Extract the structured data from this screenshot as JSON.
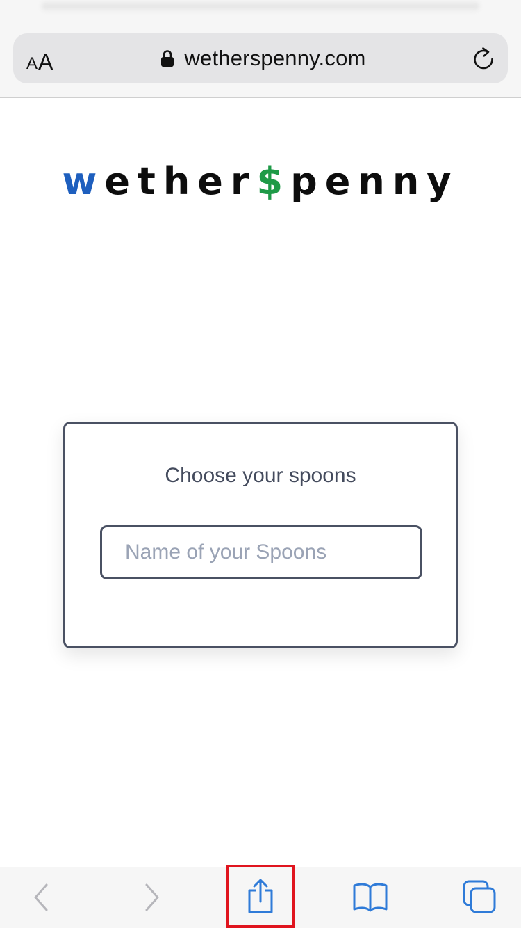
{
  "browser": {
    "text_size_button": {
      "small": "A",
      "large": "A"
    },
    "address": "wetherspenny.com",
    "lock_icon": "lock-icon",
    "reload_icon": "reload-icon"
  },
  "logo": {
    "first": "w",
    "middle": "ether",
    "dollar": "$",
    "last": "penny",
    "colors": {
      "w": "#1e5fbe",
      "middle": "#0d0d0d",
      "dollar": "#1e9a47"
    }
  },
  "card": {
    "title": "Choose your spoons",
    "input": {
      "value": "",
      "placeholder": "Name of your Spoons"
    }
  },
  "toolbar": {
    "items": [
      {
        "icon": "back-icon",
        "enabled": false
      },
      {
        "icon": "forward-icon",
        "enabled": false
      },
      {
        "icon": "share-icon",
        "enabled": true,
        "highlighted": true
      },
      {
        "icon": "bookmarks-icon",
        "enabled": true
      },
      {
        "icon": "tabs-icon",
        "enabled": true
      }
    ],
    "accent_color": "#2f7bd8",
    "disabled_color": "#b6b6bb",
    "highlight_color": "#e0141e"
  }
}
